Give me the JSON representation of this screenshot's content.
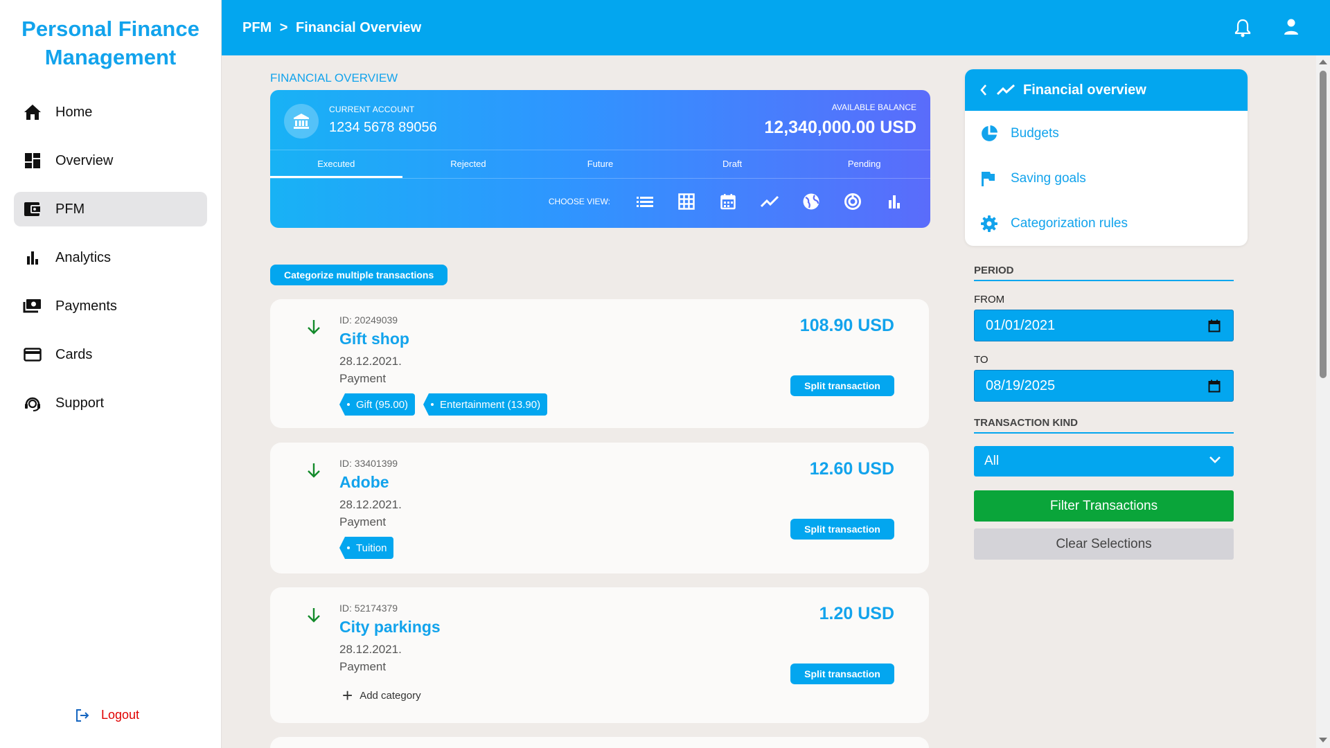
{
  "brand": {
    "line1": "Personal Finance",
    "line2": "Management"
  },
  "nav": [
    {
      "label": "Home",
      "icon": "home-icon"
    },
    {
      "label": "Overview",
      "icon": "dashboard-icon"
    },
    {
      "label": "PFM",
      "icon": "wallet-icon",
      "active": true
    },
    {
      "label": "Analytics",
      "icon": "bar-chart-icon"
    },
    {
      "label": "Payments",
      "icon": "payments-icon"
    },
    {
      "label": "Cards",
      "icon": "credit-card-icon"
    },
    {
      "label": "Support",
      "icon": "support-agent-icon"
    }
  ],
  "logout": {
    "label": "Logout"
  },
  "topbar": {
    "crumb_root": "PFM",
    "separator": ">",
    "crumb_current": "Financial Overview"
  },
  "main": {
    "section_title": "FINANCIAL OVERVIEW",
    "account": {
      "label": "CURRENT ACCOUNT",
      "number": "1234 5678 89056",
      "balance_label": "AVAILABLE BALANCE",
      "balance": "12,340,000.00 USD"
    },
    "tabs": [
      "Executed",
      "Rejected",
      "Future",
      "Draft",
      "Pending"
    ],
    "active_tab": "Executed",
    "view_label": "CHOOSE VIEW:",
    "view_icons": [
      "list-icon",
      "grid-icon",
      "calendar-icon",
      "line-chart-icon",
      "globe-icon",
      "donut-chart-icon",
      "bar-chart-icon"
    ],
    "categorize_button": "Categorize multiple transactions",
    "transactions": [
      {
        "id": "ID: 20249039",
        "name": "Gift shop",
        "date": "28.12.2021.",
        "type": "Payment",
        "amount": "108.90 USD",
        "split_label": "Split transaction",
        "tags": [
          "Gift (95.00)",
          "Entertainment (13.90)"
        ]
      },
      {
        "id": "ID: 33401399",
        "name": "Adobe",
        "date": "28.12.2021.",
        "type": "Payment",
        "amount": "12.60 USD",
        "split_label": "Split transaction",
        "tags": [
          "Tuition"
        ]
      },
      {
        "id": "ID: 52174379",
        "name": "City parkings",
        "date": "28.12.2021.",
        "type": "Payment",
        "amount": "1.20 USD",
        "split_label": "Split transaction",
        "add_category": "Add category"
      }
    ]
  },
  "panel": {
    "menu": {
      "header": "Financial overview",
      "items": [
        {
          "label": "Budgets",
          "icon": "pie-chart-icon"
        },
        {
          "label": "Saving goals",
          "icon": "flag-icon"
        },
        {
          "label": "Categorization rules",
          "icon": "gear-icon"
        }
      ]
    },
    "period_label": "PERIOD",
    "from_label": "FROM",
    "from_value": "01/01/2021",
    "to_label": "TO",
    "to_value": "08/19/2025",
    "kind_label": "TRANSACTION KIND",
    "kind_value": "All",
    "filter_button": "Filter Transactions",
    "clear_button": "Clear Selections"
  },
  "colors": {
    "primary": "#03a6ef",
    "brand_text": "#12a3ec",
    "success": "#0aa53a",
    "danger": "#e00000",
    "arrow_green": "#138a2b"
  }
}
